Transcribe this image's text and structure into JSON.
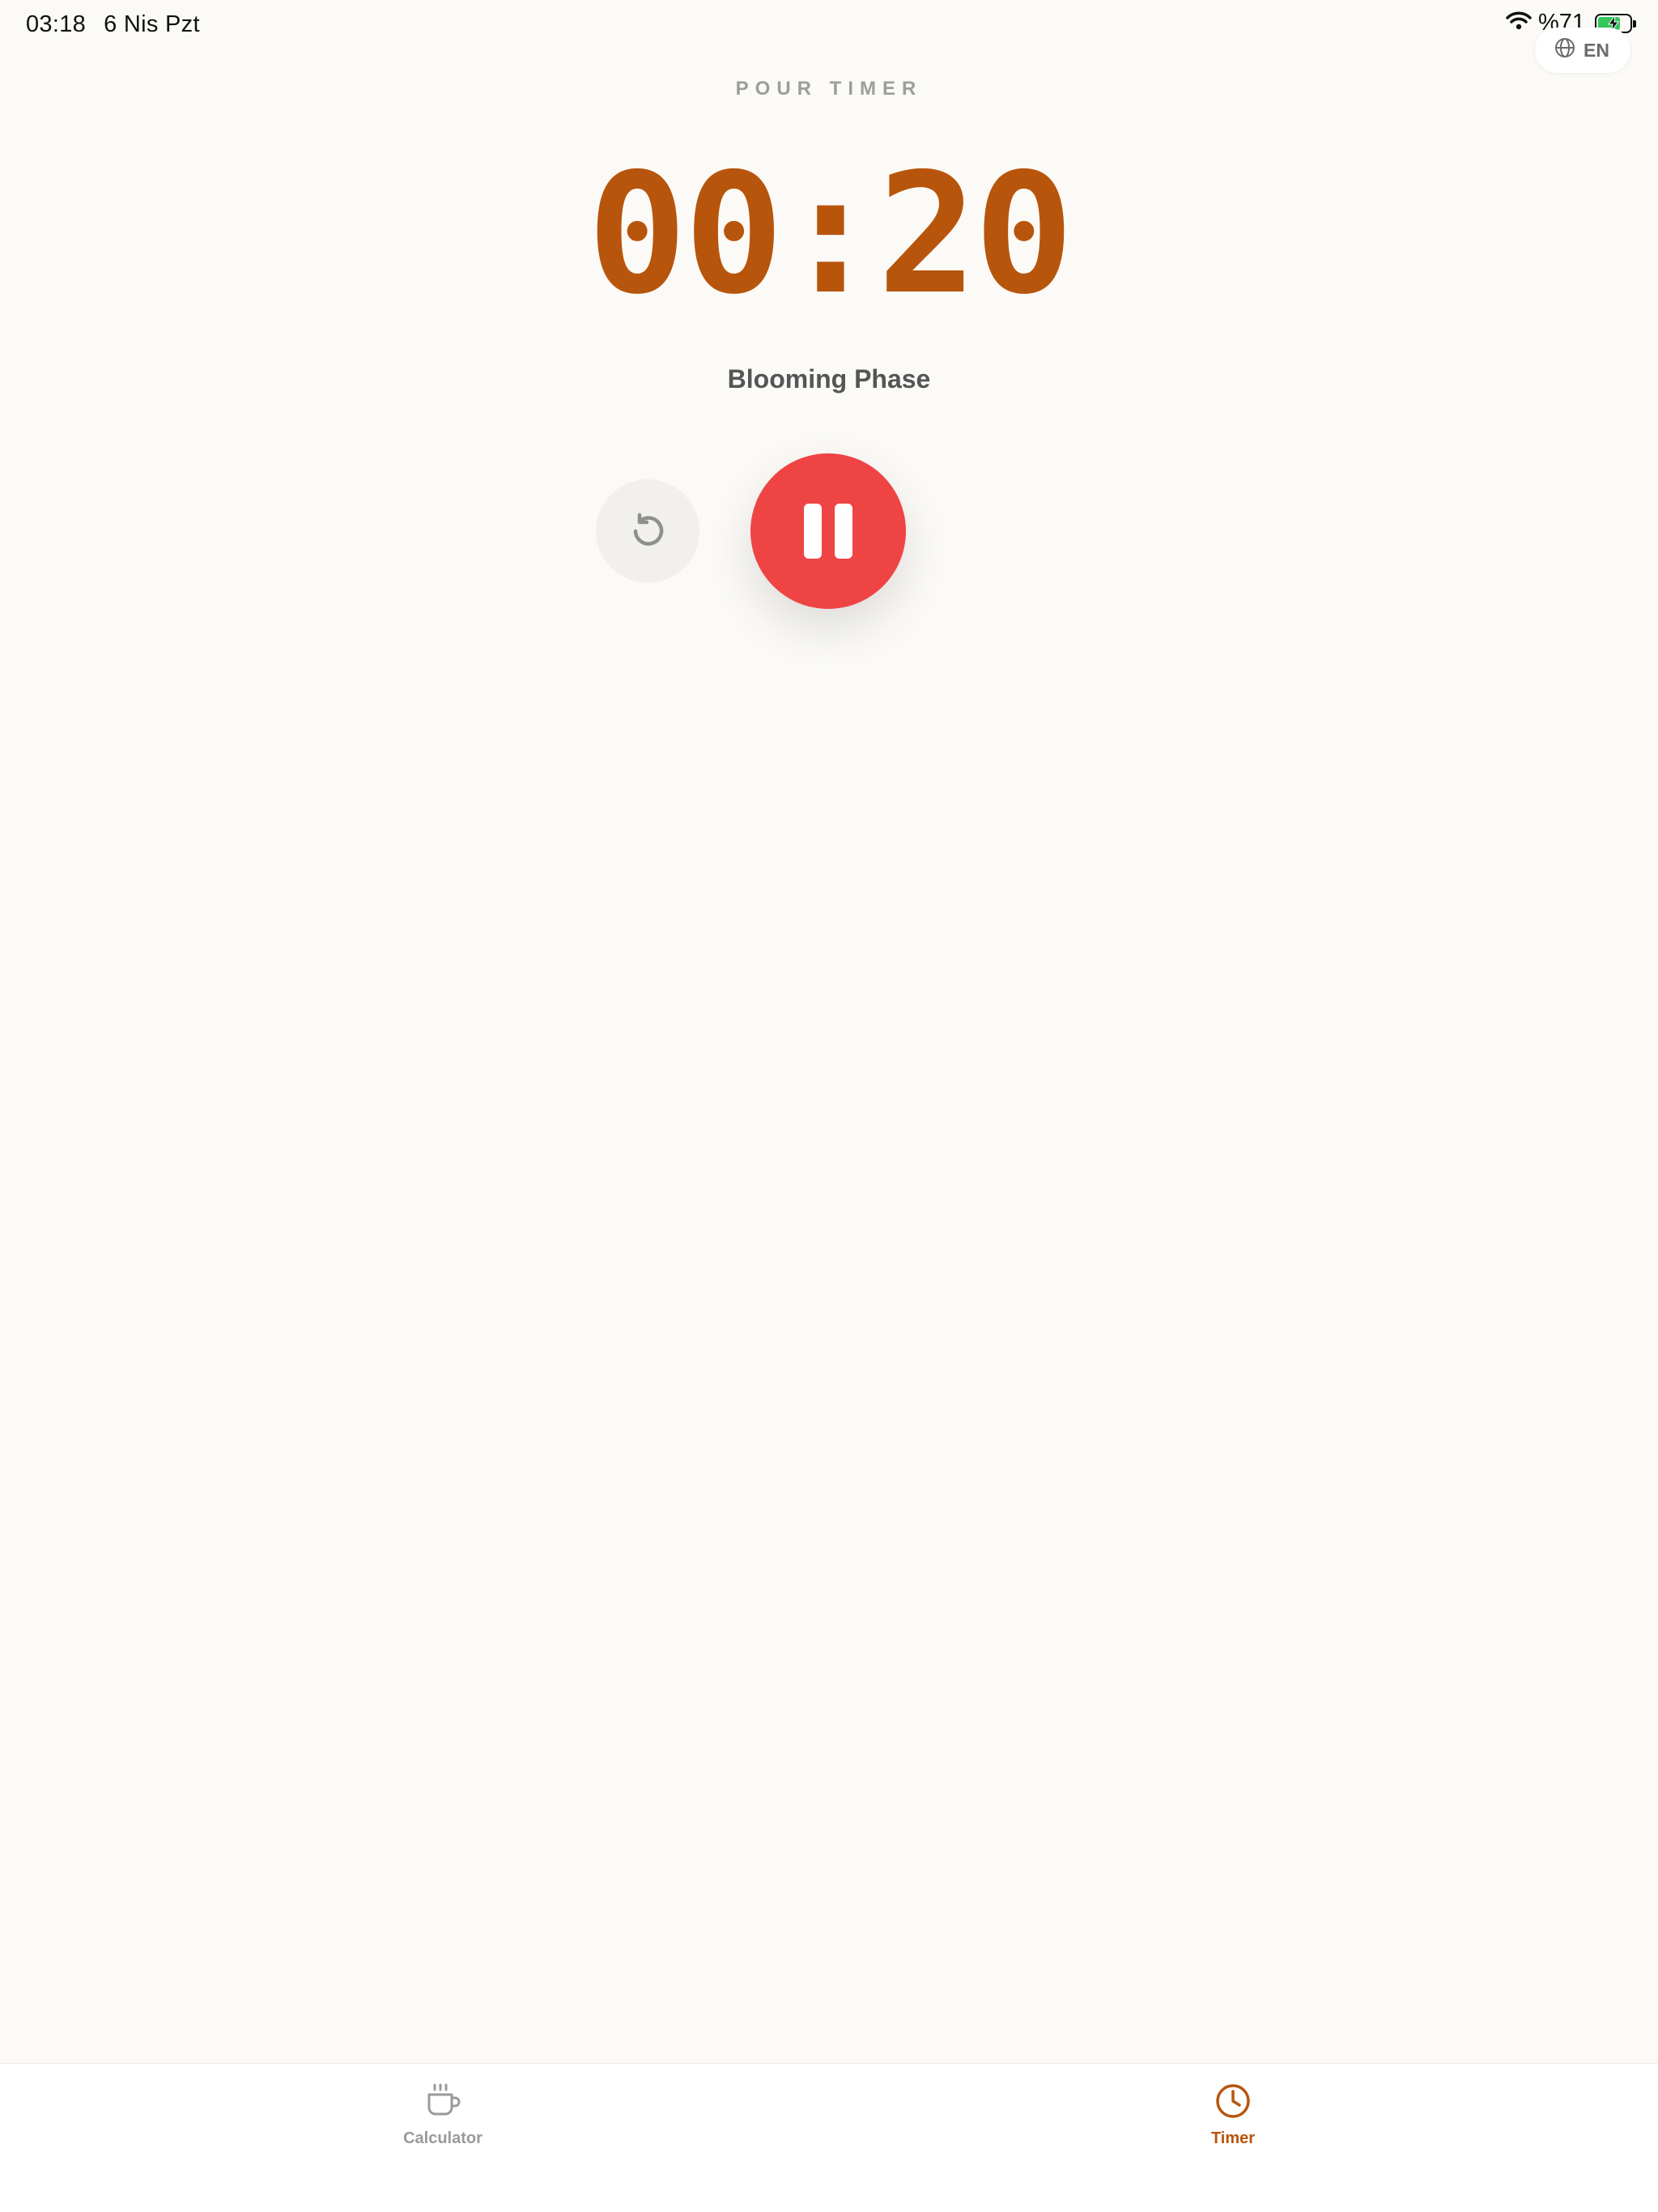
{
  "status_bar": {
    "time": "03:18",
    "date": "6 Nis Pzt",
    "battery_text": "%71",
    "battery_level": 0.71,
    "battery_charging": true
  },
  "language": {
    "code": "EN"
  },
  "timer": {
    "title": "POUR TIMER",
    "display": "00:20",
    "phase": "Blooming Phase"
  },
  "tabs": [
    {
      "label": "Calculator",
      "icon": "coffee-cup-icon",
      "active": false
    },
    {
      "label": "Timer",
      "icon": "clock-icon",
      "active": true
    }
  ],
  "colors": {
    "accent": "#b8550c",
    "pause_button": "#ef4444",
    "background": "#fbfaf7",
    "inactive_tab": "#9a9a9a"
  }
}
